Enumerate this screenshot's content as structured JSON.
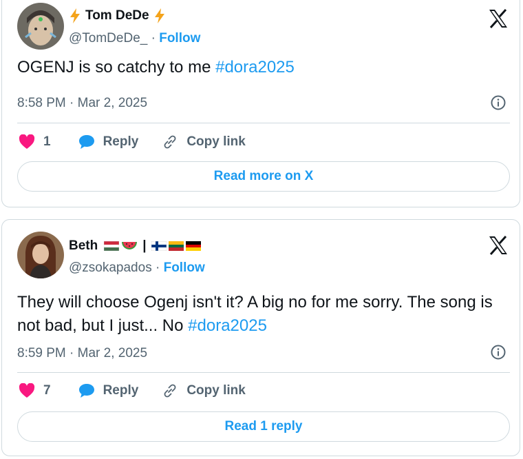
{
  "tweets": [
    {
      "display_name": "Tom DeDe",
      "name_emoji_left": "lightning-emoji",
      "name_emoji_right": "lightning-emoji",
      "handle": "@TomDeDe_",
      "dot": "·",
      "follow_label": "Follow",
      "text": "OGENJ is so catchy to me ",
      "hashtag": "#dora2025",
      "timestamp": "8:58 PM · Mar 2, 2025",
      "like_count": "1",
      "reply_label": "Reply",
      "copy_label": "Copy link",
      "read_more_label": "Read more on X"
    },
    {
      "display_name": "Beth",
      "name_separator": "|",
      "name_emojis": [
        "hungary-flag",
        "watermelon-emoji",
        "finland-flag",
        "lithuania-flag",
        "germany-flag"
      ],
      "handle": "@zsokapados",
      "dot": "·",
      "follow_label": "Follow",
      "text": "They will choose Ogenj isn't it? A big no for me sorry. The song is not bad, but I just... No ",
      "hashtag": "#dora2025",
      "timestamp": "8:59 PM · Mar 2, 2025",
      "like_count": "7",
      "reply_label": "Reply",
      "copy_label": "Copy link",
      "read_more_label": "Read 1 reply"
    }
  ],
  "colors": {
    "accent": "#1d9bf0",
    "like": "#f91880",
    "muted": "#536471",
    "border": "#cfd9de",
    "text": "#0f1419"
  }
}
